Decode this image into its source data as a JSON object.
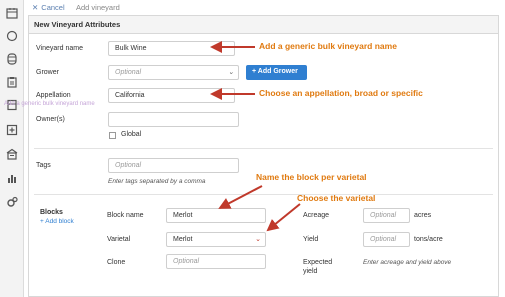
{
  "topbar": {
    "cancel_label": "Cancel",
    "breadcrumb": "Add vineyard"
  },
  "panel": {
    "title": "New Vineyard Attributes"
  },
  "form": {
    "vineyard_name_label": "Vineyard name",
    "vineyard_name_value": "Bulk Wine",
    "grower_label": "Grower",
    "grower_placeholder": "Optional",
    "add_grower_label": "Add Grower",
    "appellation_label": "Appellation",
    "appellation_value": "California",
    "owners_label": "Owner(s)",
    "global_label": "Global",
    "tags_label": "Tags",
    "tags_placeholder": "Optional",
    "tags_hint": "Enter tags separated by a comma"
  },
  "blocks": {
    "section_label": "Blocks",
    "add_block_label": "Add block",
    "block_name_label": "Block name",
    "block_name_value": "Merlot",
    "varietal_label": "Varietal",
    "varietal_value": "Merlot",
    "clone_label": "Clone",
    "clone_placeholder": "Optional",
    "acreage_label": "Acreage",
    "acreage_placeholder": "Optional",
    "acreage_unit": "acres",
    "yield_label": "Yield",
    "yield_placeholder": "Optional",
    "yield_unit": "tons/acre",
    "expected_yield_label_line1": "Expected",
    "expected_yield_label_line2": "yield",
    "expected_yield_hint": "Enter acreage and yield above"
  },
  "annotations": {
    "generic_name": "Add a generic bulk vineyard name",
    "appellation": "Choose an appellation, broad or specific",
    "block_name": "Name the block per varietal",
    "varietal": "Choose the varietal",
    "ghost_text": "Add a generic bulk vineyard name"
  },
  "colors": {
    "accent": "#2f7fd1",
    "annotation": "#e07a10",
    "arrow": "#c0392b"
  },
  "icons": [
    "calendar-icon",
    "circle-icon",
    "barrel-icon",
    "clipboard-icon",
    "list-icon",
    "plus-box-icon",
    "warehouse-icon",
    "bar-chart-icon",
    "gears-icon"
  ]
}
